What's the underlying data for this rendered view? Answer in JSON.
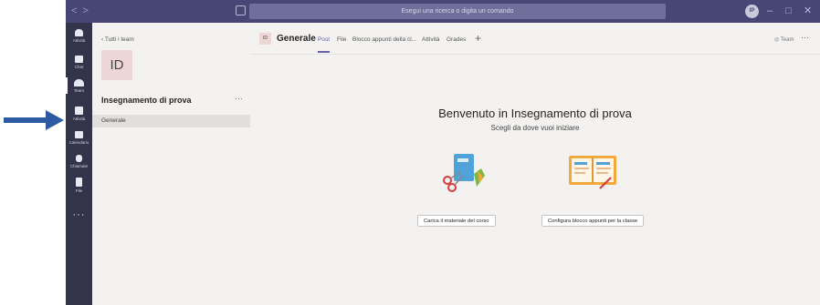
{
  "titlebar": {
    "search_text": "Esegui una ricerca o digita un comando",
    "avatar_initials": "IP",
    "window_controls": [
      "–",
      "□",
      "✕"
    ]
  },
  "rail": {
    "items": [
      {
        "label": "Attività",
        "icon": "bell-icon"
      },
      {
        "label": "Chat",
        "icon": "chat-icon"
      },
      {
        "label": "Team",
        "icon": "teams-icon",
        "active": true
      },
      {
        "label": "Attività",
        "icon": "assignments-icon"
      },
      {
        "label": "Calendario",
        "icon": "calendar-icon"
      },
      {
        "label": "Chiamate",
        "icon": "phone-icon"
      },
      {
        "label": "File",
        "icon": "file-icon"
      }
    ],
    "more": "···"
  },
  "panel": {
    "back_label": "Tutti i team",
    "team_initials": "ID",
    "team_name": "Insegnamento di prova",
    "more": "···",
    "channel": "Generale"
  },
  "channel_header": {
    "initials": "ID",
    "name": "Generale",
    "tabs": [
      "Post",
      "File",
      "Blocco appunti della cl...",
      "Attività",
      "Grades"
    ],
    "active_tab": "Post",
    "add": "+",
    "team_button": "Team",
    "more": "···"
  },
  "welcome": {
    "title": "Benvenuto in Insegnamento di prova",
    "subtitle": "Scegli da dove vuoi iniziare",
    "button_left": "Carica il materiale del corso",
    "button_right": "Configura blocco appunti per la classe"
  },
  "colors": {
    "titlebar": "#464775",
    "rail": "#33344a",
    "accent": "#6264a7",
    "pointer_arrow": "#2e5aa3"
  }
}
